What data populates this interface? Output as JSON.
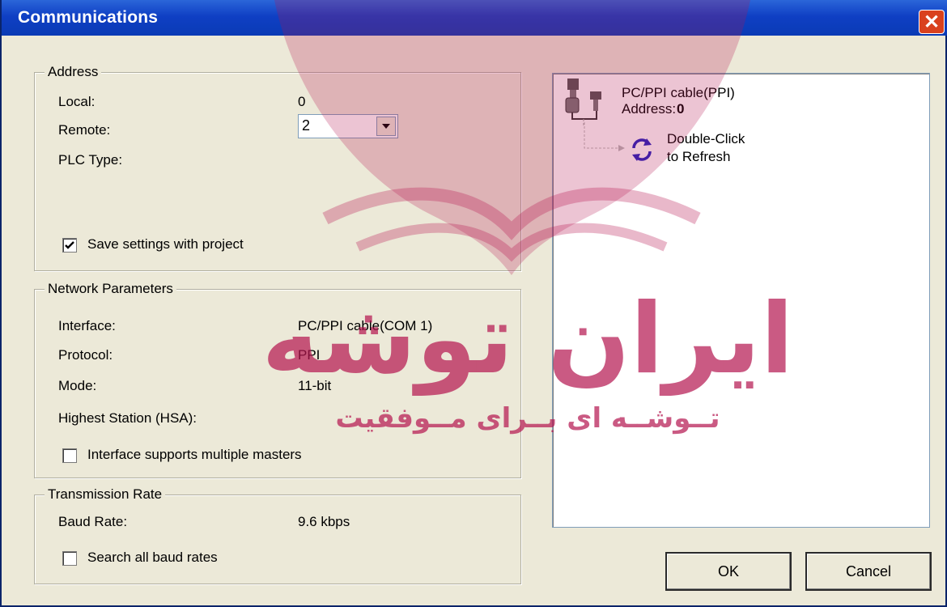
{
  "window": {
    "title": "Communications",
    "close_icon": "close-icon"
  },
  "address": {
    "legend": "Address",
    "local_label": "Local:",
    "local_value": "0",
    "remote_label": "Remote:",
    "remote_value": "2",
    "plc_type_label": "PLC Type:",
    "save_settings_label": "Save settings with project",
    "save_settings_checked": true
  },
  "network": {
    "legend": "Network Parameters",
    "interface_label": "Interface:",
    "interface_value": "PC/PPI cable(COM 1)",
    "protocol_label": "Protocol:",
    "protocol_value": "PPI",
    "mode_label": "Mode:",
    "mode_value": "11-bit",
    "hsa_label": "Highest Station (HSA):",
    "multi_master_label": "Interface supports multiple masters",
    "multi_master_checked": false
  },
  "transmission": {
    "legend": "Transmission Rate",
    "baud_label": "Baud Rate:",
    "baud_value": "9.6 kbps",
    "search_label": "Search all baud rates",
    "search_checked": false
  },
  "tree": {
    "cable_name": "PC/PPI cable(PPI)",
    "address_label": "Address:",
    "address_value": "0",
    "refresh_line1": "Double-Click",
    "refresh_line2": "to Refresh"
  },
  "buttons": {
    "ok": "OK",
    "cancel": "Cancel"
  },
  "watermark": {
    "main": "ایران توشه",
    "sub": "تــوشــه ای بــرای مــوفقیت",
    "color": "#b5154f"
  }
}
